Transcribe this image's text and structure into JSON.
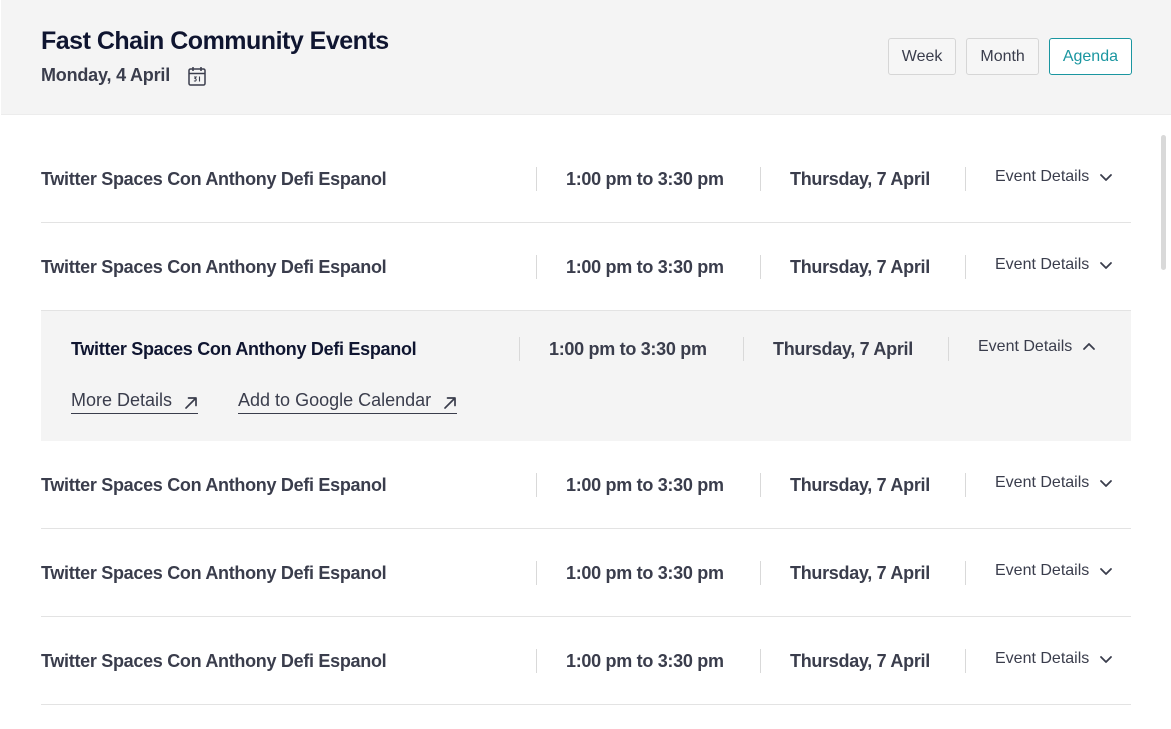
{
  "header": {
    "title": "Fast Chain Community Events",
    "date": "Monday, 4 April",
    "calendar_icon": "calendar-icon",
    "views": [
      "Week",
      "Month",
      "Agenda"
    ],
    "active_view": "Agenda"
  },
  "events": [
    {
      "title": "Twitter Spaces Con Anthony Defi Espanol",
      "time": "1:00 pm to 3:30 pm",
      "date": "Thursday, 7 April",
      "details_label": "Event Details",
      "expanded": false
    },
    {
      "title": "Twitter Spaces Con Anthony Defi Espanol",
      "time": "1:00 pm to 3:30 pm",
      "date": "Thursday, 7 April",
      "details_label": "Event Details",
      "expanded": false
    },
    {
      "title": "Twitter Spaces Con Anthony Defi Espanol",
      "time": "1:00 pm to 3:30 pm",
      "date": "Thursday, 7 April",
      "details_label": "Event Details",
      "expanded": true,
      "links": [
        "More Details",
        "Add to Google Calendar"
      ]
    },
    {
      "title": "Twitter Spaces Con Anthony Defi Espanol",
      "time": "1:00 pm to 3:30 pm",
      "date": "Thursday, 7 April",
      "details_label": "Event Details",
      "expanded": false
    },
    {
      "title": "Twitter Spaces Con Anthony Defi Espanol",
      "time": "1:00 pm to 3:30 pm",
      "date": "Thursday, 7 April",
      "details_label": "Event Details",
      "expanded": false
    },
    {
      "title": "Twitter Spaces Con Anthony Defi Espanol",
      "time": "1:00 pm to 3:30 pm",
      "date": "Thursday, 7 April",
      "details_label": "Event Details",
      "expanded": false
    }
  ],
  "colors": {
    "accent": "#1a96a0",
    "header_bg": "#f4f4f4",
    "title_text": "#0f1530",
    "body_text": "#3a3d4c"
  }
}
